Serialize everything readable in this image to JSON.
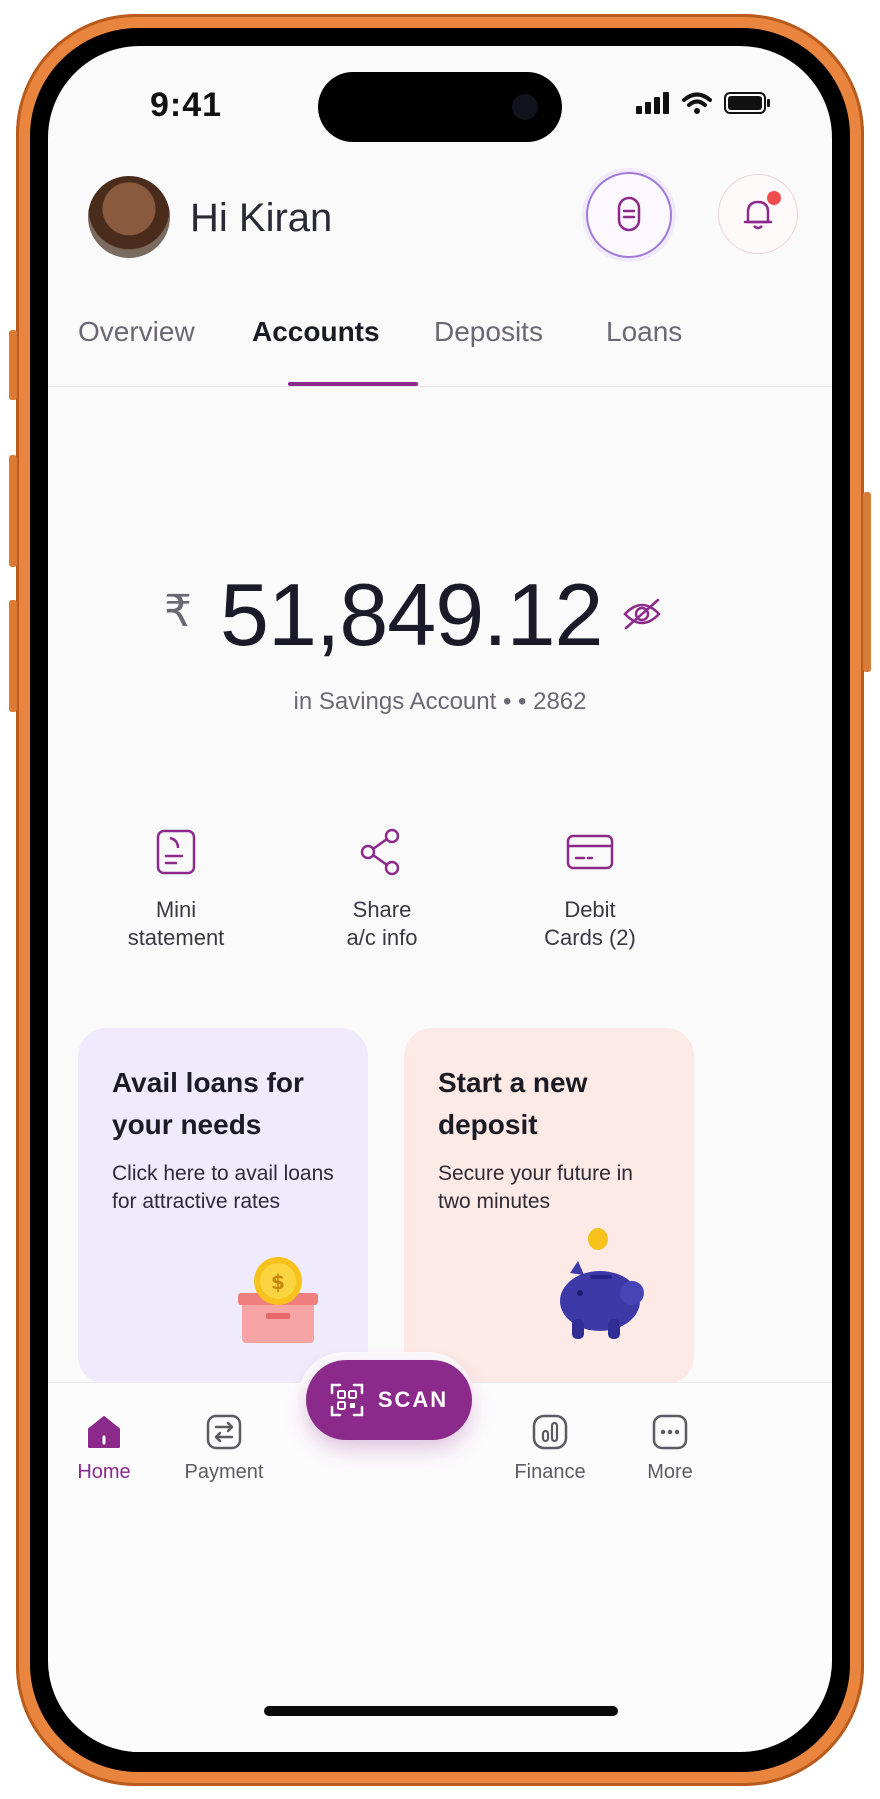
{
  "status_bar": {
    "time": "9:41"
  },
  "header": {
    "greeting": "Hi Kiran"
  },
  "tabs": [
    {
      "label": "Overview"
    },
    {
      "label": "Accounts",
      "active": true
    },
    {
      "label": "Deposits"
    },
    {
      "label": "Loans"
    }
  ],
  "balance": {
    "currency_symbol": "₹",
    "amount": "51,849.12",
    "account_info": "in Savings Account • • 2862"
  },
  "quick_actions": [
    {
      "line1": "Mini",
      "line2": "statement",
      "icon": "document-icon"
    },
    {
      "line1": "Share",
      "line2": "a/c info",
      "icon": "share-icon"
    },
    {
      "line1": "Debit",
      "line2": "Cards (2)",
      "icon": "card-icon"
    }
  ],
  "cards": {
    "loan": {
      "title": "Avail loans for your needs",
      "desc": "Click here to avail loans for attractive rates"
    },
    "deposit": {
      "title": "Start a new deposit",
      "desc": "Secure your future in two minutes"
    }
  },
  "bottom_nav": {
    "home": "Home",
    "payment": "Payment",
    "scan": "SCAN",
    "finance": "Finance",
    "more": "More"
  },
  "colors": {
    "accent": "#8c2a8c",
    "frame": "#e9853f"
  }
}
